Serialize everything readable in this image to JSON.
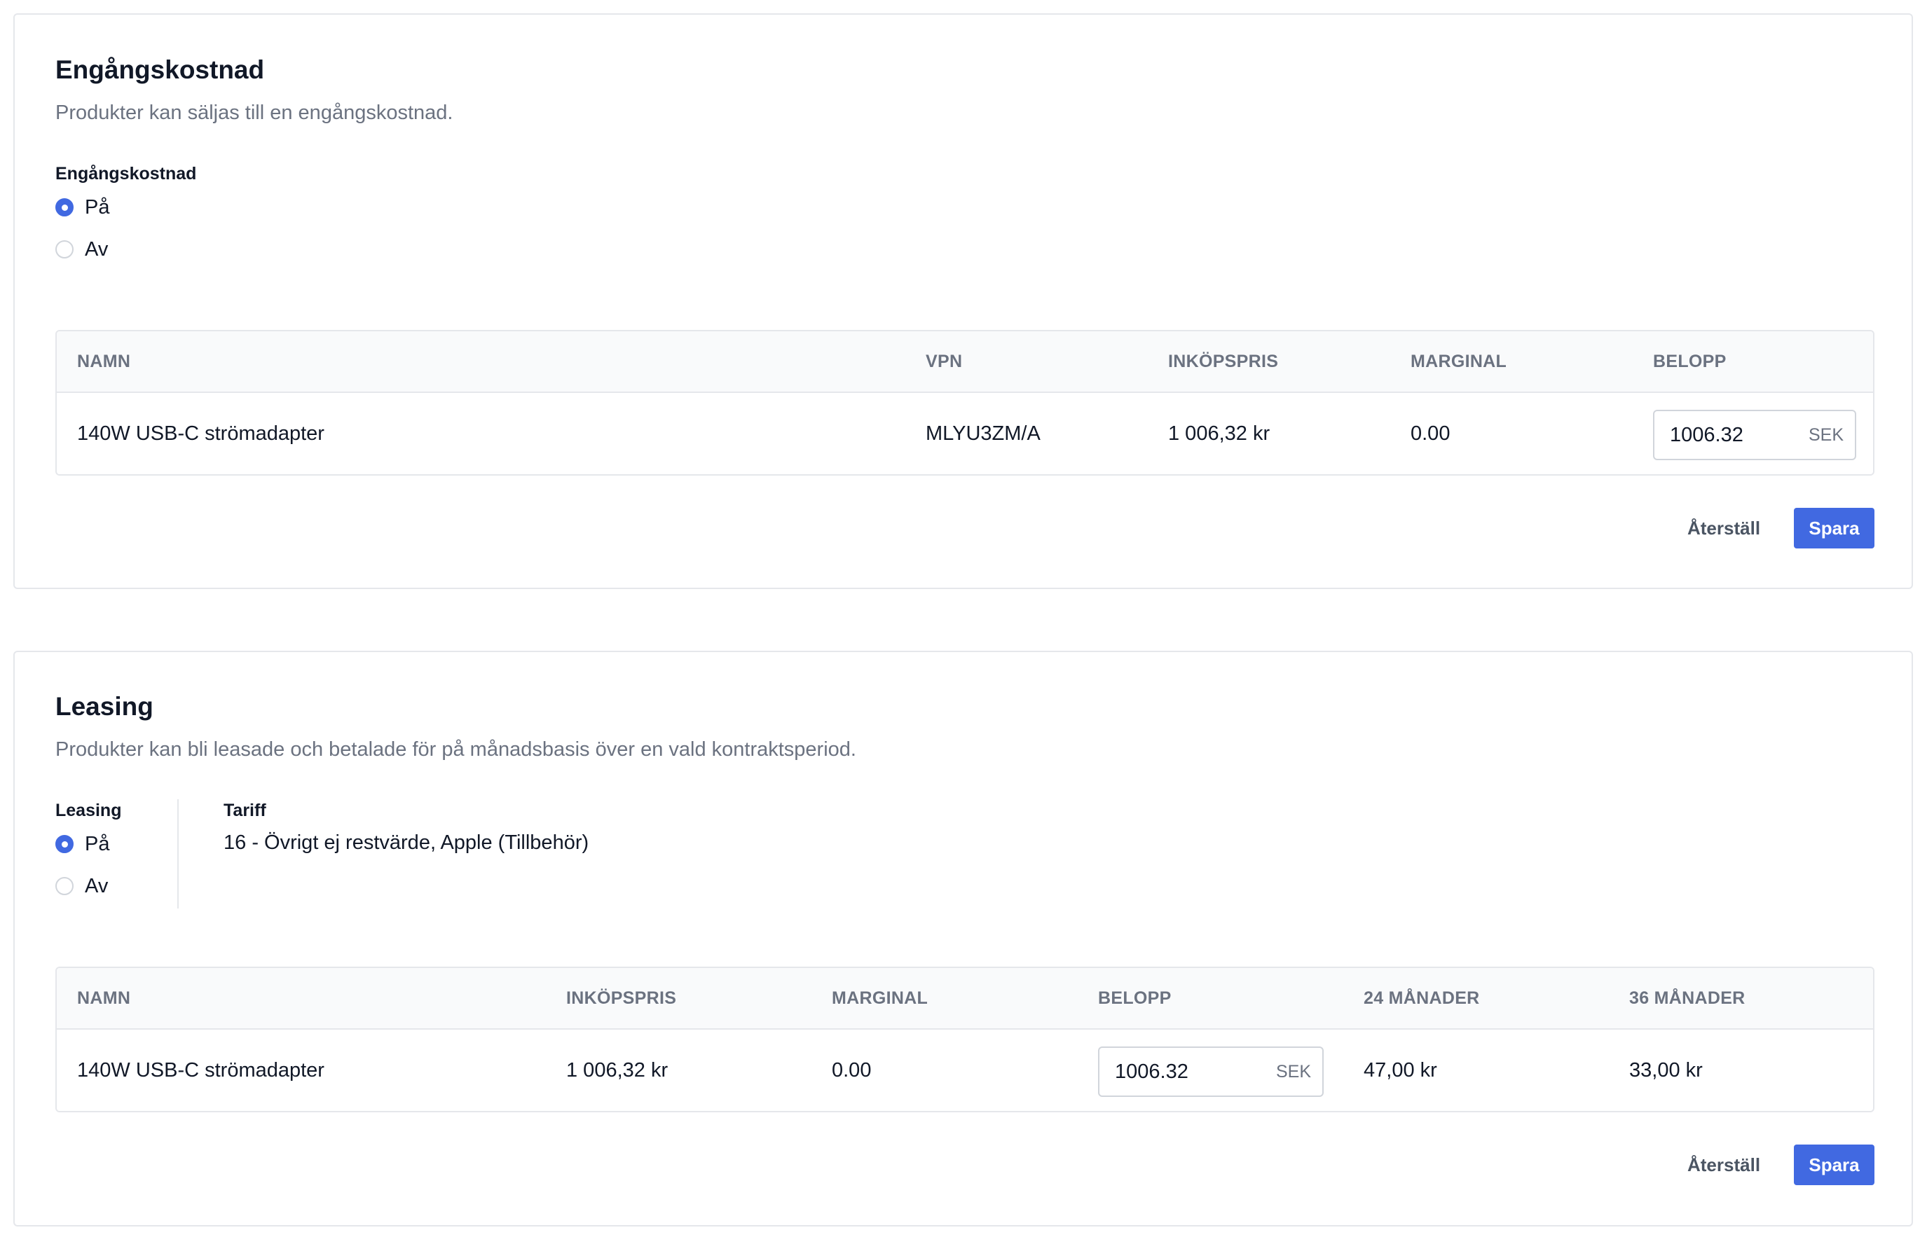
{
  "one_time": {
    "title": "Engångskostnad",
    "subtitle": "Produkter kan säljas till en engångskostnad.",
    "field_label": "Engångskostnad",
    "options": [
      {
        "label": "På",
        "checked": true
      },
      {
        "label": "Av",
        "checked": false
      }
    ],
    "table": {
      "headers": [
        "NAMN",
        "VPN",
        "INKÖPSPRIS",
        "MARGINAL",
        "BELOPP"
      ],
      "row": {
        "name": "140W USB-C strömadapter",
        "vpn": "MLYU3ZM/A",
        "purchase_price": "1 006,32 kr",
        "margin": "0.00",
        "amount": "1006.32",
        "currency": "SEK"
      }
    },
    "reset_label": "Återställ",
    "save_label": "Spara"
  },
  "leasing": {
    "title": "Leasing",
    "subtitle": "Produkter kan bli leasade och betalade för på månadsbasis över en vald kontraktsperiod.",
    "field_label": "Leasing",
    "options": [
      {
        "label": "På",
        "checked": true
      },
      {
        "label": "Av",
        "checked": false
      }
    ],
    "tariff_label": "Tariff",
    "tariff_value": "16 - Övrigt ej restvärde, Apple (Tillbehör)",
    "table": {
      "headers": [
        "NAMN",
        "INKÖPSPRIS",
        "MARGINAL",
        "BELOPP",
        "24 MÅNADER",
        "36 MÅNADER"
      ],
      "row": {
        "name": "140W USB-C strömadapter",
        "purchase_price": "1 006,32 kr",
        "margin": "0.00",
        "amount": "1006.32",
        "currency": "SEK",
        "months_24": "47,00 kr",
        "months_36": "33,00 kr"
      }
    },
    "reset_label": "Återställ",
    "save_label": "Spara"
  },
  "colors": {
    "accent": "#4169e1",
    "border": "#e5e7eb",
    "muted_text": "#6b7280"
  }
}
